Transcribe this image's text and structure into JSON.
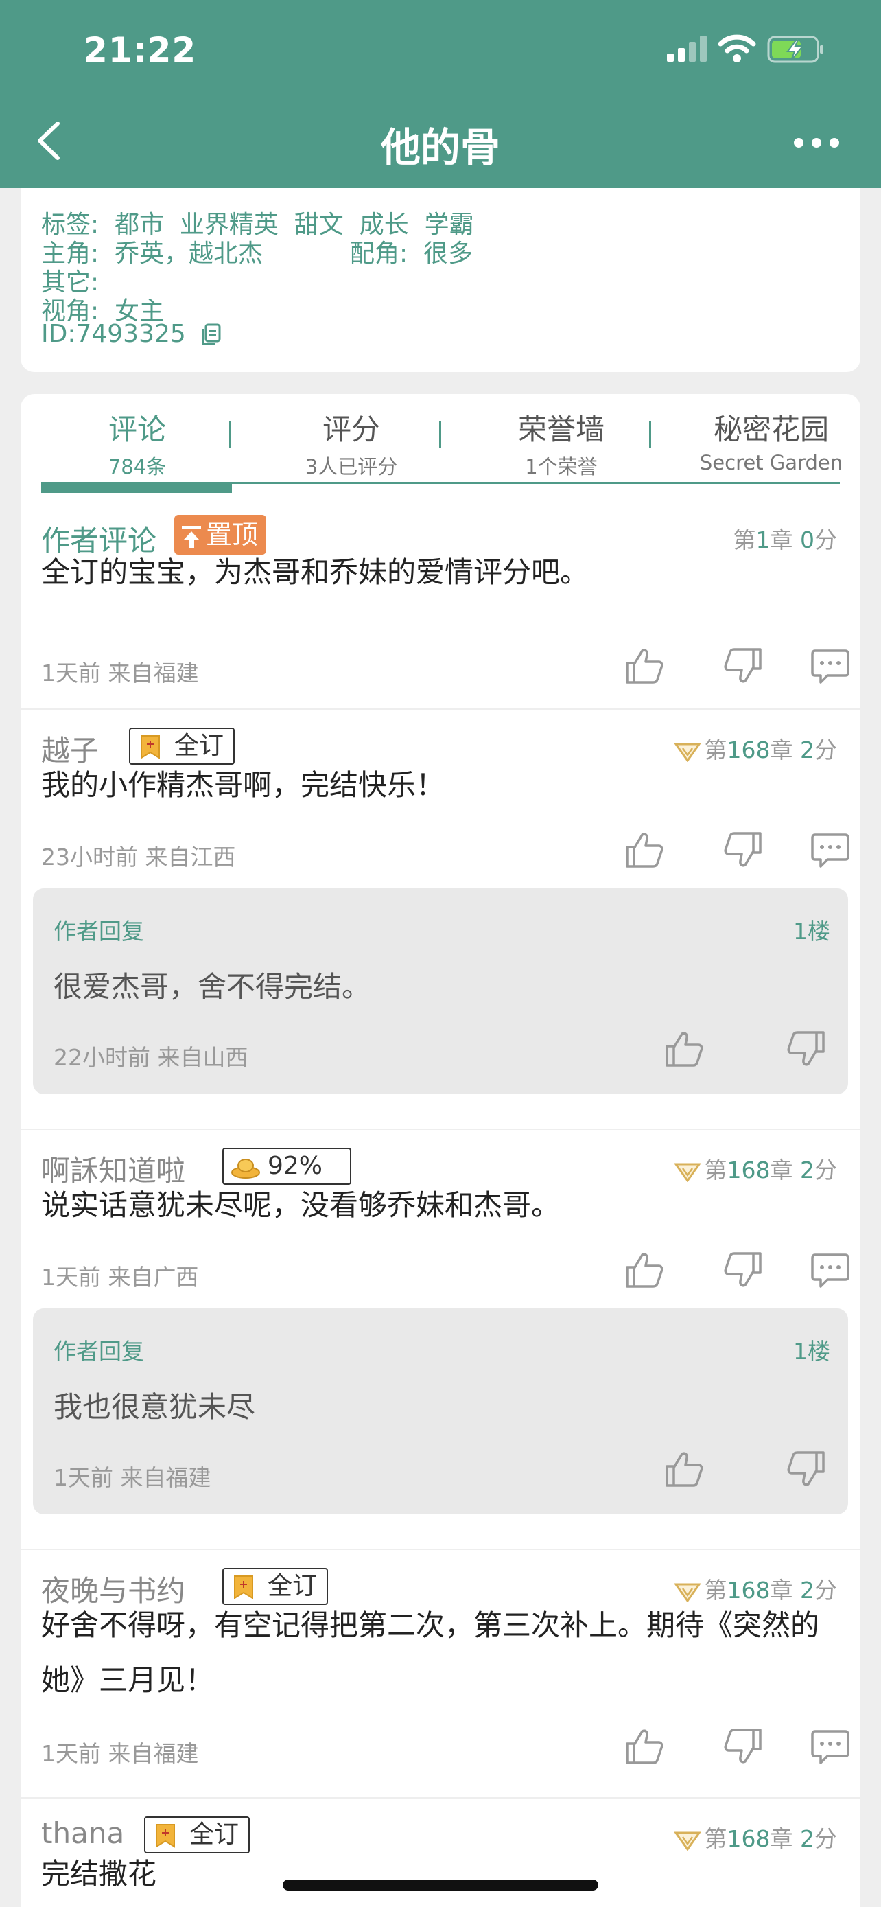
{
  "status": {
    "time": "21:22"
  },
  "nav": {
    "title": "他的骨"
  },
  "info": {
    "tags_label": "标签:",
    "tags": "都市  业界精英  甜文  成长  学霸",
    "lead_label": "主角:",
    "lead": "乔英，越北杰",
    "support_label": "配角:",
    "support": "很多",
    "other_label": "其它:",
    "view_label": "视角:",
    "view": "女主",
    "id": "ID:7493325"
  },
  "tabs": [
    {
      "title": "评论",
      "sub": "784条"
    },
    {
      "title": "评分",
      "sub": "3人已评分"
    },
    {
      "title": "荣誉墙",
      "sub": "1个荣誉"
    },
    {
      "title": "秘密花园",
      "sub": "Secret Garden"
    }
  ],
  "pinned": {
    "name": "作者评论",
    "pin_label": "置顶",
    "chap_pre": "第",
    "chap_num": "1",
    "chap_mid": "章",
    "score": "0",
    "score_unit": "分",
    "text": "全订的宝宝，为杰哥和乔妹的爱情评分吧。",
    "meta": "1天前  来自福建"
  },
  "comments": [
    {
      "name": "越子",
      "badge": "全订",
      "chap_pre": "第",
      "chap_num": "168",
      "chap_mid": "章",
      "score": "2",
      "score_unit": "分",
      "text": "我的小作精杰哥啊，完结快乐！",
      "meta": "23小时前  来自江西",
      "reply": {
        "head": "作者回复",
        "floor": "1楼",
        "text": "很爱杰哥，舍不得完结。",
        "meta": "22小时前  来自山西"
      }
    },
    {
      "name": "啊訸知道啦",
      "badge": "92%",
      "chap_pre": "第",
      "chap_num": "168",
      "chap_mid": "章",
      "score": "2",
      "score_unit": "分",
      "text": "说实话意犹未尽呢，没看够乔妹和杰哥。",
      "meta": "1天前  来自广西",
      "reply": {
        "head": "作者回复",
        "floor": "1楼",
        "text": "我也很意犹未尽",
        "meta": "1天前  来自福建"
      }
    },
    {
      "name": "夜晚与书约",
      "badge": "全订",
      "chap_pre": "第",
      "chap_num": "168",
      "chap_mid": "章",
      "score": "2",
      "score_unit": "分",
      "text": "好舍不得呀，有空记得把第二次，第三次补上。期待《突然的她》三月见！",
      "meta": "1天前  来自福建"
    },
    {
      "name": "thana",
      "badge": "全订",
      "chap_pre": "第",
      "chap_num": "168",
      "chap_mid": "章",
      "score": "2",
      "score_unit": "分",
      "text": "完结撒花"
    }
  ],
  "colors": {
    "primary": "#4f9a88",
    "pin": "#ec8a4e",
    "gold": "#f2b43b"
  }
}
